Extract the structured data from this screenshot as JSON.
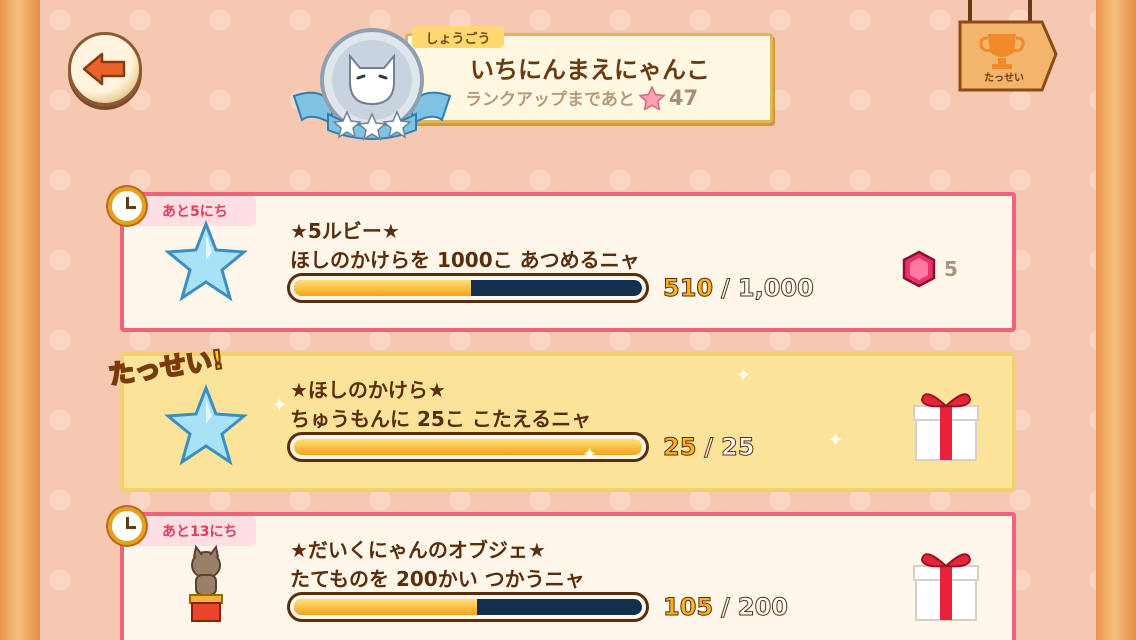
{
  "header": {
    "title_tag": "しょうごう",
    "title_name": "いちにんまえにゃんこ",
    "rankup_label": "ランクアップまであと",
    "rankup_count": "47",
    "trophy_label": "たっせい"
  },
  "missions": [
    {
      "days_left": "あと5にち",
      "title": "★5ルビー★",
      "description": "ほしのかけらを 1000こ あつめるニャ",
      "progress_current": "510",
      "progress_separator": "/",
      "progress_total": "1,000",
      "progress_fraction": 0.51,
      "reward_count": "5",
      "icon": "star-shard-icon",
      "reward_icon": "ruby-icon",
      "status": "active"
    },
    {
      "done_label": "たっせい!",
      "title": "★ほしのかけら★",
      "description": "ちゅうもんに 25こ こたえるニャ",
      "progress_current": "25",
      "progress_separator": "/",
      "progress_total": "25",
      "progress_fraction": 1.0,
      "icon": "star-shard-icon",
      "reward_icon": "gift-box-icon",
      "status": "completed"
    },
    {
      "days_left": "あと13にち",
      "title": "★だいくにゃんのオブジェ★",
      "description": "たてものを 200かい つかうニャ",
      "progress_current": "105",
      "progress_separator": "/",
      "progress_total": "200",
      "progress_fraction": 0.525,
      "icon": "carpenter-cat-statue-icon",
      "reward_icon": "gift-box-icon",
      "status": "active"
    }
  ],
  "colors": {
    "active_border": "#f1637a",
    "done_background": "#fbe49a",
    "progress_fill": "#f7a416",
    "progress_track": "#12304d",
    "text_brown": "#5a2d0c"
  }
}
